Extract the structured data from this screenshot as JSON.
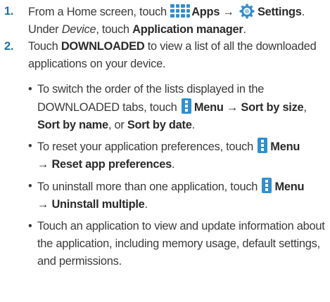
{
  "steps": [
    {
      "number": "1.",
      "line1_pre": "From a Home screen, touch",
      "apps": "Apps",
      "arrow": "→",
      "settings": "Settings",
      "period": ".",
      "line2_pre": "Under",
      "device": "Device",
      "line2_mid": ", touch",
      "app_manager": "Application manager",
      "line2_end": "."
    },
    {
      "number": "2.",
      "pre": "Touch",
      "downloaded": "DOWNLOADED",
      "post": "to view a list of all the downloaded applications on your device."
    }
  ],
  "bullets": [
    {
      "dot": "•",
      "pre": "To switch the order of the lists displayed in the DOWNLOADED tabs, touch",
      "menu": "Menu",
      "arrow": "→",
      "sort_size": "Sort by size",
      "comma1": ",",
      "sort_name": "Sort by name",
      "or": ", or",
      "sort_date": "Sort by date",
      "end": "."
    },
    {
      "dot": "•",
      "pre": "To reset your application preferences, touch",
      "menu": "Menu",
      "arrow_item": "→ Reset app preferences",
      "end": "."
    },
    {
      "dot": "•",
      "pre": "To uninstall more than one application, touch",
      "menu": "Menu",
      "arrow_item": "→ Uninstall multiple",
      "end": "."
    },
    {
      "dot": "•",
      "text": "Touch an application to view and update information about the application, including memory usage, default settings, and permissions."
    }
  ],
  "icons": {
    "apps": "apps-grid-icon",
    "settings": "settings-gear-icon",
    "menu": "menu-icon"
  },
  "colors": {
    "step_number": "#1d6fa8",
    "icon_blue": "#2f8fd0",
    "text": "#3a3a3a"
  }
}
